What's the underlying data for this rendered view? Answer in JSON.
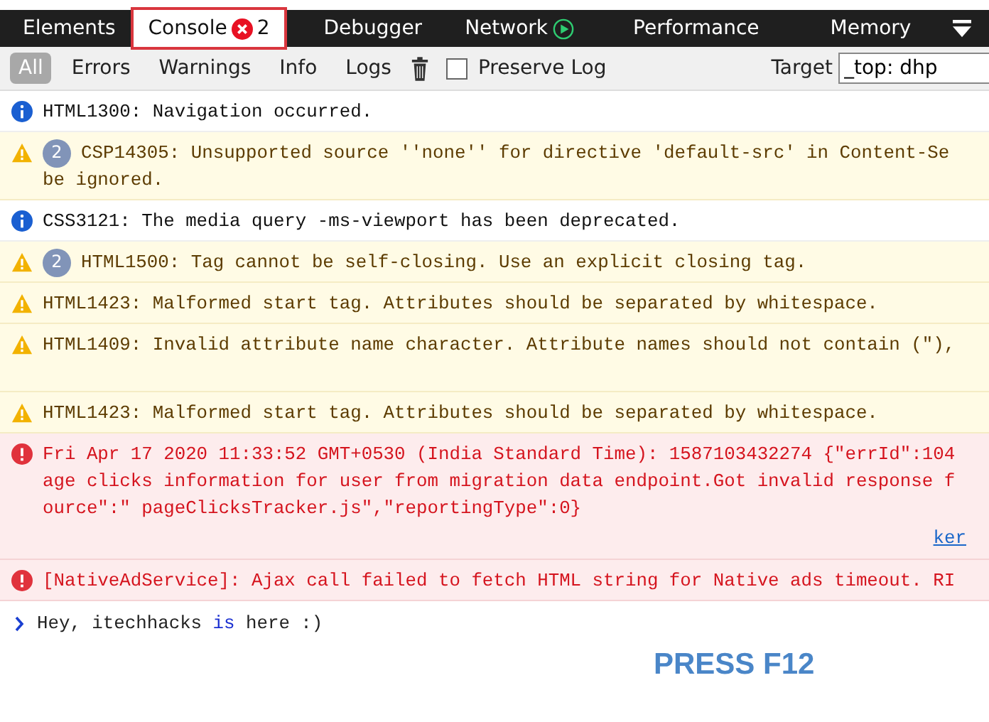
{
  "tabs": [
    {
      "label": "Elements",
      "selected": false,
      "highlighted": false
    },
    {
      "label": "Console",
      "selected": true,
      "highlighted": true,
      "kind": "error_count",
      "badge_count": "2"
    },
    {
      "label": "Debugger",
      "selected": false,
      "highlighted": false
    },
    {
      "label": "Network",
      "selected": false,
      "highlighted": false,
      "kind": "recording"
    },
    {
      "label": "Performance",
      "selected": false,
      "highlighted": false
    },
    {
      "label": "Memory",
      "selected": false,
      "highlighted": false
    }
  ],
  "filters": [
    {
      "label": "All",
      "selected": true
    },
    {
      "label": "Errors",
      "selected": false
    },
    {
      "label": "Warnings",
      "selected": false
    },
    {
      "label": "Info",
      "selected": false
    },
    {
      "label": "Logs",
      "selected": false
    }
  ],
  "preserve_log": {
    "label": "Preserve Log",
    "checked": false
  },
  "target": {
    "label": "Target",
    "value": "_top: dhp"
  },
  "messages": [
    {
      "kind": "info",
      "lines": [
        "HTML1300: Navigation occurred."
      ]
    },
    {
      "kind": "warning",
      "count": "2",
      "lines": [
        "CSP14305: Unsupported source ''none'' for directive 'default-src' in Content-Se",
        "be ignored."
      ]
    },
    {
      "kind": "info",
      "lines": [
        "CSS3121: The media query -ms-viewport has been deprecated."
      ]
    },
    {
      "kind": "warning",
      "count": "2",
      "lines": [
        "HTML1500: Tag cannot be self-closing. Use an explicit closing tag."
      ]
    },
    {
      "kind": "warning",
      "lines": [
        "HTML1423: Malformed start tag. Attributes should be separated by whitespace."
      ]
    },
    {
      "kind": "warning",
      "wrapped": true,
      "lines": [
        "HTML1409: Invalid attribute name character. Attribute names should not contain (\"),"
      ]
    },
    {
      "kind": "warning",
      "lines": [
        "HTML1423: Malformed start tag. Attributes should be separated by whitespace."
      ]
    },
    {
      "kind": "error",
      "lines": [
        "Fri Apr 17 2020 11:33:52 GMT+0530 (India Standard Time): 1587103432274 {\"errId\":104",
        "age clicks information for user from migration data endpoint.Got invalid response f",
        "ource\":\" pageClicksTracker.js\",\"reportingType\":0}"
      ],
      "source": "ker"
    },
    {
      "kind": "error",
      "lines": [
        "[NativeAdService]: Ajax call failed to fetch HTML string for Native ads timeout. RI"
      ]
    }
  ],
  "input": [
    {
      "kind": "plain",
      "text": "Hey, itechhacks "
    },
    {
      "kind": "keyword",
      "text": "is"
    },
    {
      "kind": "plain",
      "text": " here :)"
    }
  ],
  "overlay_text": "PRESS F12"
}
